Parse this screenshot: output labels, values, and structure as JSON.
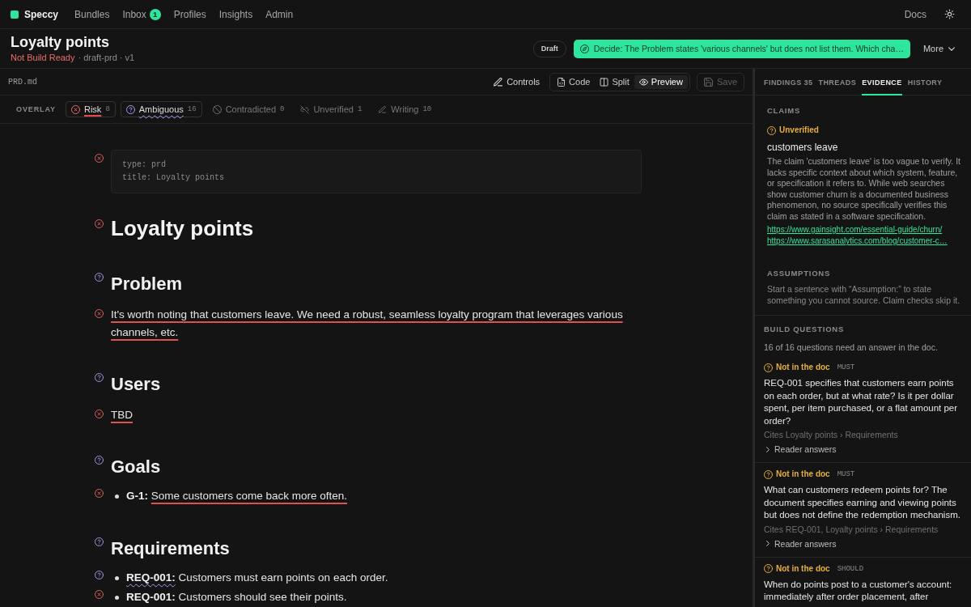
{
  "nav": {
    "brand": "Speccy",
    "items": [
      {
        "label": "Bundles",
        "selected": false
      },
      {
        "label": "Inbox",
        "badge": "1",
        "selected": false
      },
      {
        "label": "Profiles",
        "selected": false
      },
      {
        "label": "Insights",
        "selected": false
      },
      {
        "label": "Admin",
        "selected": false
      }
    ],
    "docs": "Docs"
  },
  "header": {
    "title": "Loyalty points",
    "status": "Not Build Ready",
    "build_ready": false,
    "meta": "· draft-prd · v1",
    "badge": "Draft",
    "banner": "Decide: The Problem states 'various channels' but does not list them. Which cha…",
    "more": "More"
  },
  "editor": {
    "filename": "PRD.md",
    "controls": "Controls",
    "views": [
      {
        "label": "Code",
        "kind": "code",
        "selected": false
      },
      {
        "label": "Split",
        "kind": "split",
        "selected": false
      },
      {
        "label": "Preview",
        "kind": "preview",
        "selected": true
      }
    ],
    "save": {
      "label": "Save",
      "disabled": true
    },
    "overlay": {
      "label": "OVERLAY",
      "chips": [
        {
          "label": "Risk",
          "count": "8",
          "kind": "risk",
          "on": true
        },
        {
          "label": "Ambiguous",
          "count": "16",
          "kind": "ambiguous",
          "on": true
        },
        {
          "label": "Contradicted",
          "count": "0",
          "kind": "contradicted",
          "on": false
        },
        {
          "label": "Unverified",
          "count": "1",
          "kind": "unverified",
          "on": false
        },
        {
          "label": "Writing",
          "count": "10",
          "kind": "writing",
          "on": false
        }
      ]
    },
    "blocks": [
      {
        "kind": "frontmatter",
        "marker": {
          "kind": "risk"
        },
        "lines": [
          "type: prd",
          "title: Loyalty points"
        ]
      },
      {
        "kind": "h1",
        "marker": {
          "kind": "risk"
        },
        "text": "Loyalty points"
      },
      {
        "kind": "h2",
        "marker": {
          "kind": "ambiguous"
        },
        "text": "Problem"
      },
      {
        "kind": "paragraph",
        "marker": {
          "kind": "risk"
        },
        "text": "It's worth noting that customers leave. We need a robust, seamless loyalty program that leverages various channels, etc.",
        "underlined": true
      },
      {
        "kind": "h2",
        "marker": {
          "kind": "ambiguous"
        },
        "text": "Users"
      },
      {
        "kind": "paragraph",
        "marker": {
          "kind": "risk"
        },
        "text": "TBD",
        "underlined": true
      },
      {
        "kind": "h2",
        "marker": {
          "kind": "ambiguous"
        },
        "text": "Goals"
      },
      {
        "kind": "bullet",
        "marker": {
          "kind": "risk"
        },
        "label": "G-1:",
        "text": "Some customers come back more often.",
        "label_underlined": false,
        "text_underlined": true
      },
      {
        "kind": "h2",
        "marker": {
          "kind": "ambiguous"
        },
        "text": "Requirements"
      },
      {
        "kind": "bullet",
        "marker": {
          "kind": "ambiguous"
        },
        "label": "REQ-001:",
        "text": "Customers must earn points on each order.",
        "label_underlined": true,
        "text_underlined": false
      },
      {
        "kind": "bullet",
        "marker": {
          "kind": "risk"
        },
        "label": "REQ-001:",
        "text": "Customers should see their points.",
        "label_underlined": false,
        "text_underlined": false
      }
    ]
  },
  "panel": {
    "tabs": [
      {
        "label": "FINDINGS 35",
        "selected": false
      },
      {
        "label": "THREADS",
        "selected": false
      },
      {
        "label": "EVIDENCE",
        "selected": true
      },
      {
        "label": "HISTORY",
        "selected": false
      }
    ],
    "claims": {
      "heading": "CLAIMS",
      "items": [
        {
          "status": "Unverified",
          "kind": "unverified",
          "claim": "customers leave",
          "explanation": "The claim 'customers leave' is too vague to verify. It lacks specific context about which system, feature, or specification it refers to. While web searches show customer churn is a documented business phenomenon, no source specifically verifies this claim as stated in a software specification.",
          "links": [
            "https://www.gainsight.com/essential-guide/churn/",
            "https://www.sarasanalytics.com/blog/customer-c…"
          ]
        }
      ]
    },
    "assumptions": {
      "heading": "ASSUMPTIONS",
      "text": "Start a sentence with “Assumption:” to state something you cannot source. Claim checks skip it."
    },
    "questions": {
      "heading": "BUILD QUESTIONS",
      "summary": "16 of 16 questions need an answer in the doc.",
      "items": [
        {
          "status": "Not in the doc",
          "kind": "missing",
          "priority": "MUST",
          "text": "REQ-001 specifies that customers earn points on each order, but at what rate? Is it per dollar spent, per item purchased, or a flat amount per order?",
          "cites": "Cites Loyalty points › Requirements",
          "answers": "Reader answers",
          "expanded": false
        },
        {
          "status": "Not in the doc",
          "kind": "missing",
          "priority": "MUST",
          "text": "What can customers redeem points for? The document specifies earning and viewing points but does not define the redemption mechanism.",
          "cites": "Cites REQ-001, Loyalty points › Requirements",
          "answers": "Reader answers",
          "expanded": false
        },
        {
          "status": "Not in the doc",
          "kind": "missing",
          "priority": "SHOULD",
          "text": "When do points post to a customer's account: immediately after order placement, after"
        }
      ]
    }
  }
}
